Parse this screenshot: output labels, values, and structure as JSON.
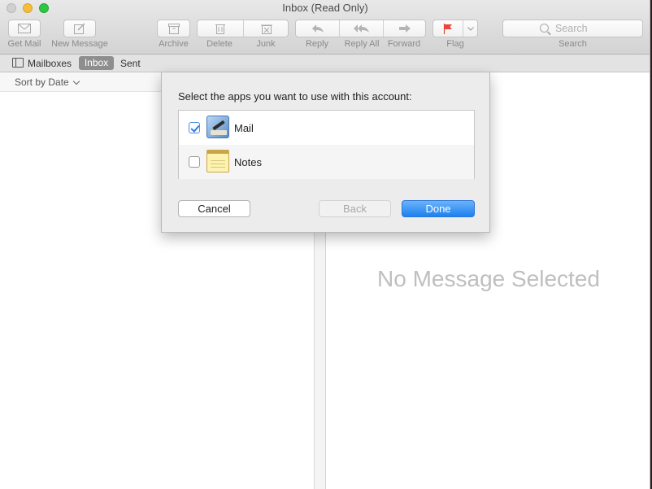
{
  "window": {
    "title": "Inbox (Read Only)"
  },
  "toolbar": {
    "get_mail": "Get Mail",
    "new_message": "New Message",
    "archive": "Archive",
    "delete": "Delete",
    "junk": "Junk",
    "reply": "Reply",
    "reply_all": "Reply All",
    "forward": "Forward",
    "flag": "Flag",
    "search_placeholder": "Search",
    "search_label": "Search"
  },
  "favorites": {
    "mailboxes": "Mailboxes",
    "inbox": "Inbox",
    "sent": "Sent"
  },
  "message_list": {
    "sort_label": "Sort by Date"
  },
  "viewer": {
    "empty_text": "No Message Selected"
  },
  "dialog": {
    "prompt": "Select the apps you want to use with this account:",
    "apps": [
      {
        "name": "Mail",
        "checked": true,
        "icon": "mail-app-icon"
      },
      {
        "name": "Notes",
        "checked": false,
        "icon": "notes-app-icon"
      }
    ],
    "cancel": "Cancel",
    "back": "Back",
    "done": "Done"
  },
  "colors": {
    "accent": "#1d80f0",
    "flag": "#e8453c"
  }
}
